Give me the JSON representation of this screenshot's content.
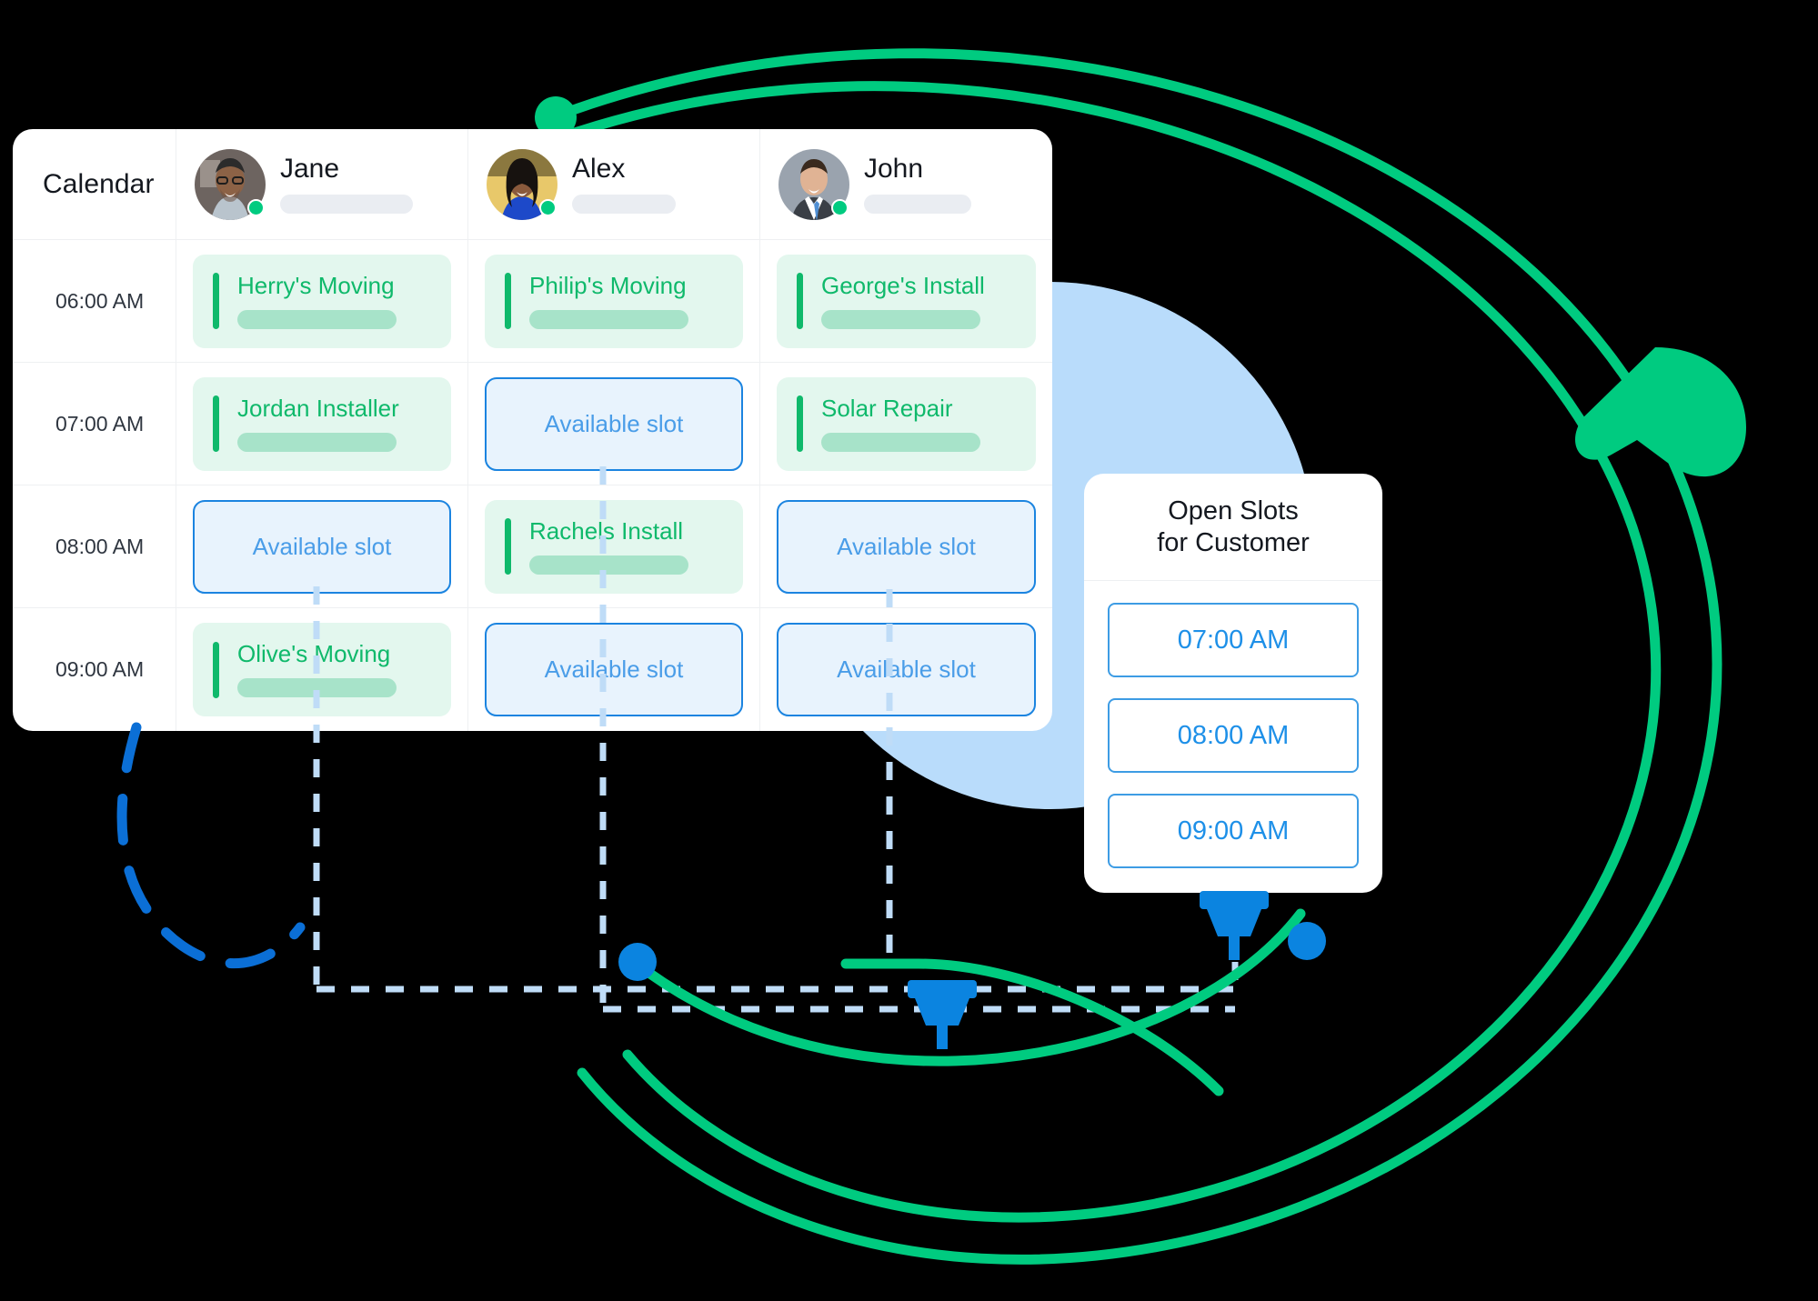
{
  "calendar": {
    "title": "Calendar",
    "columns": [
      {
        "name": "Jane",
        "avatar": "avatar-jane",
        "status": "online"
      },
      {
        "name": "Alex",
        "avatar": "avatar-alex",
        "status": "online"
      },
      {
        "name": "John",
        "avatar": "avatar-john",
        "status": "online"
      }
    ],
    "times": [
      "06:00 AM",
      "07:00 AM",
      "08:00 AM",
      "09:00 AM"
    ],
    "slot_label": "Available slot",
    "rows": [
      {
        "time": "06:00 AM",
        "cells": [
          {
            "type": "event",
            "title": "Herry's Moving"
          },
          {
            "type": "event",
            "title": "Philip's Moving"
          },
          {
            "type": "event",
            "title": "George's Install"
          }
        ]
      },
      {
        "time": "07:00 AM",
        "cells": [
          {
            "type": "event",
            "title": "Jordan Installer"
          },
          {
            "type": "slot",
            "title": "Available slot"
          },
          {
            "type": "event",
            "title": "Solar Repair"
          }
        ]
      },
      {
        "time": "08:00 AM",
        "cells": [
          {
            "type": "slot",
            "title": "Available slot"
          },
          {
            "type": "event",
            "title": "Rachels Install"
          },
          {
            "type": "slot",
            "title": "Available slot"
          }
        ]
      },
      {
        "time": "09:00 AM",
        "cells": [
          {
            "type": "event",
            "title": "Olive's Moving"
          },
          {
            "type": "slot",
            "title": "Available slot"
          },
          {
            "type": "slot",
            "title": "Available slot"
          }
        ]
      }
    ]
  },
  "open_slots": {
    "title": "Open Slots\nfor Customer",
    "slots": [
      "07:00 AM",
      "08:00 AM",
      "09:00 AM"
    ]
  },
  "colors": {
    "background": "#000000",
    "card": "#ffffff",
    "event_bg": "#e3f7ee",
    "event_accent": "#0fb96b",
    "slot_bg": "#e8f3fd",
    "slot_border": "#1b84e0",
    "slot_text": "#4a9de8",
    "green_arc": "#00cb80",
    "blue_dot": "#0b84e0",
    "blue_circle": "#b9dcfb",
    "dashed_blue": "#bfdcf7",
    "dashed_dark_blue": "#0b6fd6",
    "status_dot": "#00cb80"
  },
  "decorations": {
    "green_arcs": 2,
    "green_node_top": "green-node",
    "green_arrow_right": "green-cursor-arrow",
    "blue_plug_bottom_right": "blue-plug-icon",
    "blue_plug_bottom_center": "blue-plug-icon",
    "blue_dot_small": "blue-dot",
    "blue_dashed_arc": "dashed-arc",
    "connector_lines": "dashed-connectors"
  }
}
